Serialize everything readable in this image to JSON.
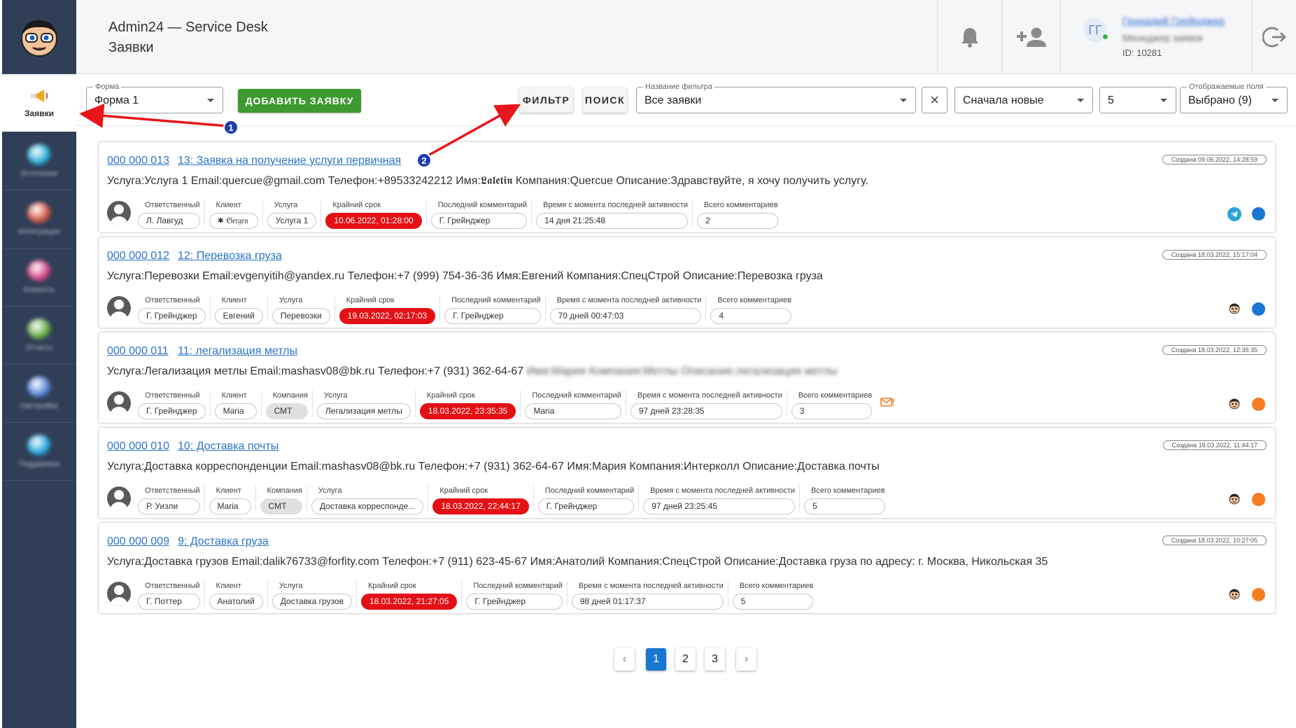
{
  "header": {
    "app_title": "Admin24 — Service Desk",
    "page_title": "Заявки",
    "user": {
      "initials": "ГГ",
      "name": "Геннадий Грейнджер",
      "role": "Менеджер заявок",
      "id_text": "ID: 10281"
    }
  },
  "sidebar": {
    "items": [
      {
        "label": "Заявки",
        "blob": "#e8a840"
      },
      {
        "label": "Источники",
        "blob": "#2db0d6"
      },
      {
        "label": "Интеграции",
        "blob": "#d65a4a"
      },
      {
        "label": "Клиенты",
        "blob": "#d64a8a"
      },
      {
        "label": "Отчеты",
        "blob": "#6ab04c"
      },
      {
        "label": "Настройки",
        "blob": "#5a8ad6"
      },
      {
        "label": "Поддержка",
        "blob": "#2aa8e0"
      }
    ]
  },
  "toolbar": {
    "form_label": "Форма",
    "form_value": "Форма 1",
    "add_button": "ДОБАВИТЬ ЗАЯВКУ",
    "filter_button": "ФИЛЬТР",
    "search_button": "ПОИСК",
    "filter_name_label": "Название фильтра",
    "filter_name_value": "Все заявки",
    "clear_icon": "×",
    "sort_value": "Сначала новые",
    "per_page_value": "5",
    "fields_label": "Отображаемые поля",
    "fields_value": "Выбрано (9)"
  },
  "tickets": [
    {
      "id": "000 000 013",
      "title": "13: Заявка на получение услуги первичная",
      "created": "Создана 09.06.2022, 14:28:59",
      "description": "Услуга:Услуга 1 Email:quercue@gmail.com Телефон:+89533242212 Имя:𝕷𝖆𝖑𝖊𝖙𝖎𝖓 Компания:Quercue Описание:Здравствуйте, я хочу получить услугу.",
      "description_hidden": "",
      "fields": [
        {
          "label": "Ответственный",
          "value": "Л. Лавгуд"
        },
        {
          "label": "Клиент",
          "value": "🟋 𝔊𝔢𝔯𝔤𝔢𝔫"
        },
        {
          "label": "Услуга",
          "value": "Услуга 1"
        },
        {
          "label": "Крайний срок",
          "value": "10.06.2022, 01:28:00",
          "style": "red"
        },
        {
          "label": "Последний комментарий",
          "value": "Г. Грейнджер"
        },
        {
          "label": "Время с момента последней активности",
          "value": "14 дня 21:25:48"
        },
        {
          "label": "Всего комментариев",
          "value": "2"
        }
      ],
      "source_icon": "telegram-icon",
      "status_color": "#1976d2",
      "mail_icon": false
    },
    {
      "id": "000 000 012",
      "title": "12: Перевозка груза",
      "created": "Создана 18.03.2022, 15:17:04",
      "description": "Услуга:Перевозки Email:evgenyitih@yandex.ru Телефон:+7 (999) 754-36-36 Имя:Евгений Компания:СпецСтрой Описание:Перевозка груза",
      "description_hidden": "",
      "fields": [
        {
          "label": "Ответственный",
          "value": "Г. Грейнджер"
        },
        {
          "label": "Клиент",
          "value": "Евгений"
        },
        {
          "label": "Услуга",
          "value": "Перевозки"
        },
        {
          "label": "Крайний срок",
          "value": "19.03.2022, 02:17:03",
          "style": "red"
        },
        {
          "label": "Последний комментарий",
          "value": "Г. Грейнджер"
        },
        {
          "label": "Время с момента последней активности",
          "value": "70 дней 00:47:03"
        },
        {
          "label": "Всего комментариев",
          "value": "4"
        }
      ],
      "source_icon": "face-icon",
      "status_color": "#1976d2",
      "mail_icon": false
    },
    {
      "id": "000 000 011",
      "title": "11: легализация метлы",
      "created": "Создана 18.03.2022, 12:35:35",
      "description": "Услуга:Легализация метлы Email:mashasv08@bk.ru Телефон:+7 (931) 362-64-67",
      "description_hidden": "Имя:Мария Компания:Метлы Описание:легализация метлы",
      "fields": [
        {
          "label": "Ответственный",
          "value": "Г. Грейнджер"
        },
        {
          "label": "Клиент",
          "value": "Maria"
        },
        {
          "label": "Компания",
          "value": "СМТ",
          "style": "grey"
        },
        {
          "label": "Услуга",
          "value": "Легализация метлы"
        },
        {
          "label": "Крайний срок",
          "value": "18.03.2022, 23:35:35",
          "style": "red"
        },
        {
          "label": "Последний комментарий",
          "value": "Maria"
        },
        {
          "label": "Время с момента последней активности",
          "value": "97 дней 23:28:35"
        },
        {
          "label": "Всего комментариев",
          "value": "3"
        }
      ],
      "source_icon": "face-icon",
      "status_color": "#f57c23",
      "mail_icon": true
    },
    {
      "id": "000 000 010",
      "title": "10: Доставка почты",
      "created": "Создана 18.03.2022, 11:44:17",
      "description": "Услуга:Доставка корреспонденции Email:mashasv08@bk.ru Телефон:+7 (931) 362-64-67 Имя:Мария Компания:Интерколл Описание:Доставка почты",
      "description_hidden": "",
      "fields": [
        {
          "label": "Ответственный",
          "value": "Р. Уизли"
        },
        {
          "label": "Клиент",
          "value": "Maria"
        },
        {
          "label": "Компания",
          "value": "СМТ",
          "style": "grey"
        },
        {
          "label": "Услуга",
          "value": "Доставка корреспонде..."
        },
        {
          "label": "Крайний срок",
          "value": "18.03.2022, 22:44:17",
          "style": "red"
        },
        {
          "label": "Последний комментарий",
          "value": "Г. Грейнджер"
        },
        {
          "label": "Время с момента последней активности",
          "value": "97 дней 23:25:45"
        },
        {
          "label": "Всего комментариев",
          "value": "5"
        }
      ],
      "source_icon": "face-icon",
      "status_color": "#f57c23",
      "mail_icon": false
    },
    {
      "id": "000 000 009",
      "title": "9: Доставка груза",
      "created": "Создана 18.03.2022, 10:27:05",
      "description": "Услуга:Доставка грузов Email:dalik76733@forfity.com Телефон:+7 (911) 623-45-67 Имя:Анатолий Компания:СпецСтрой Описание:Доставка груза по адресу: г. Москва, Никольская 35",
      "description_hidden": "",
      "fields": [
        {
          "label": "Ответственный",
          "value": "Г. Поттер"
        },
        {
          "label": "Клиент",
          "value": "Анатолий"
        },
        {
          "label": "Услуга",
          "value": "Доставка грузов"
        },
        {
          "label": "Крайний срок",
          "value": "18.03.2022, 21:27:05",
          "style": "red"
        },
        {
          "label": "Последний комментарий",
          "value": "Г. Грейнджер"
        },
        {
          "label": "Время с момента последней активности",
          "value": "98 дней 01:17:37"
        },
        {
          "label": "Всего комментариев",
          "value": "5"
        }
      ],
      "source_icon": "face-icon",
      "status_color": "#f57c23",
      "mail_icon": false
    }
  ],
  "pagination": {
    "prev": "‹",
    "pages": [
      "1",
      "2",
      "3"
    ],
    "current": "1",
    "next": "›"
  },
  "annotations": [
    {
      "label": "1"
    },
    {
      "label": "2"
    }
  ]
}
